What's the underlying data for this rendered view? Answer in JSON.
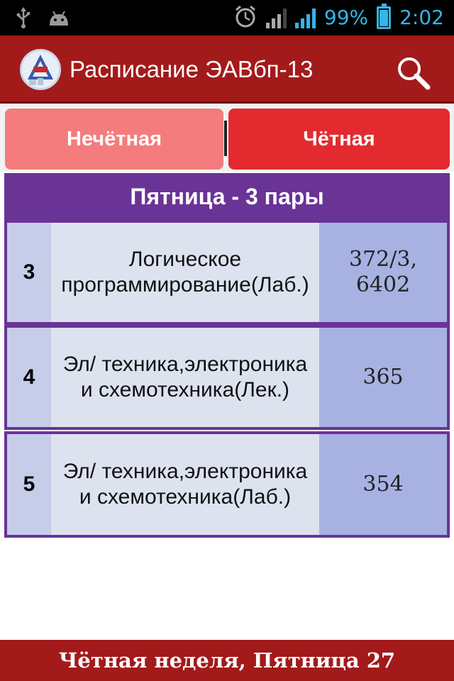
{
  "status_bar": {
    "left_icons": [
      "usb-icon",
      "android-icon"
    ],
    "right_icons": [
      "alarm-icon",
      "signal-icon",
      "signal-icon",
      "battery-icon"
    ],
    "battery_percent": "99%",
    "time": "2:02"
  },
  "action_bar": {
    "title": "Расписание ЭАВбп-13",
    "logo_icon": "university-logo-icon",
    "search_icon": "search-icon"
  },
  "tabs": [
    {
      "label": "Нечётная",
      "color": "#f47c7c"
    },
    {
      "label": "Чётная",
      "color": "#e32b2f"
    }
  ],
  "day_header": "Пятница - 3 пары",
  "lessons": [
    {
      "number": "3",
      "subject": "Логическое программирование(Лаб.)",
      "room": "372/3, 6402"
    },
    {
      "number": "4",
      "subject": "Эл/ техника,электроника и схемотехника(Лек.)",
      "room": "365"
    },
    {
      "number": "5",
      "subject": "Эл/ техника,электроника и схемотехника(Лаб.)",
      "room": "354"
    }
  ],
  "footer": "Чётная неделя, Пятница 27",
  "colors": {
    "action_bar": "#a31a1b",
    "header_purple": "#6a3396",
    "number_cell": "#c6cde9",
    "subject_cell": "#dde2ef",
    "room_cell": "#a7b2e3"
  }
}
